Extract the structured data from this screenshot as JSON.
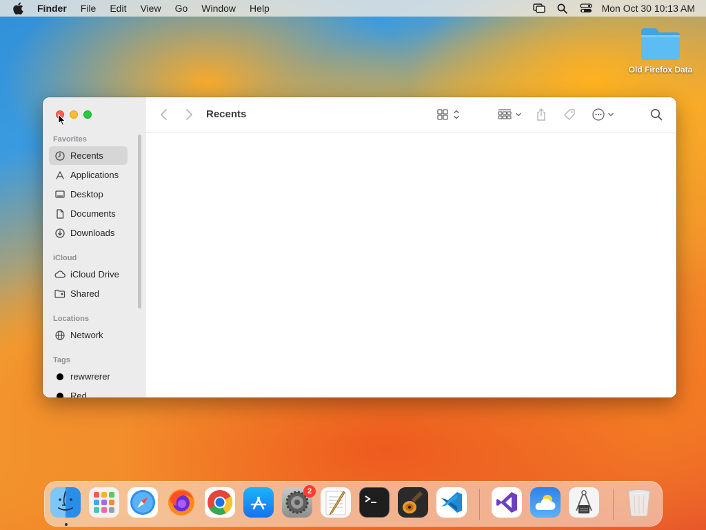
{
  "menubar": {
    "app_name": "Finder",
    "items": [
      "File",
      "Edit",
      "View",
      "Go",
      "Window",
      "Help"
    ],
    "clock": "Mon Oct 30  10:13 AM"
  },
  "desktop": {
    "folder_label": "Old Firefox Data"
  },
  "finder": {
    "title": "Recents",
    "sidebar": {
      "favorites_header": "Favorites",
      "favorites": [
        {
          "label": "Recents",
          "icon": "clock-icon"
        },
        {
          "label": "Applications",
          "icon": "applications-icon"
        },
        {
          "label": "Desktop",
          "icon": "desktop-icon"
        },
        {
          "label": "Documents",
          "icon": "document-icon"
        },
        {
          "label": "Downloads",
          "icon": "download-icon"
        }
      ],
      "icloud_header": "iCloud",
      "icloud": [
        {
          "label": "iCloud Drive",
          "icon": "cloud-icon"
        },
        {
          "label": "Shared",
          "icon": "shared-folder-icon"
        }
      ],
      "locations_header": "Locations",
      "locations": [
        {
          "label": "Network",
          "icon": "globe-icon"
        }
      ],
      "tags_header": "Tags",
      "tags": [
        {
          "label": "rewwrerer",
          "color": "#000000"
        },
        {
          "label": "Red",
          "color": "#000000"
        }
      ]
    }
  },
  "dock": {
    "apps": [
      "Finder",
      "Launchpad",
      "Safari",
      "Firefox",
      "Chrome",
      "App Store",
      "System Settings",
      "TextEdit",
      "Terminal",
      "GarageBand",
      "VS Code",
      "Visual Studio",
      "Weather",
      "Directory Utility",
      "Trash"
    ],
    "settings_badge": "2"
  },
  "colors": {
    "close": "#fe5f57",
    "minimize": "#febc2e",
    "maximize": "#28c840",
    "sidebar_bg": "#ececec",
    "selected_bg": "#d6d6d6"
  }
}
